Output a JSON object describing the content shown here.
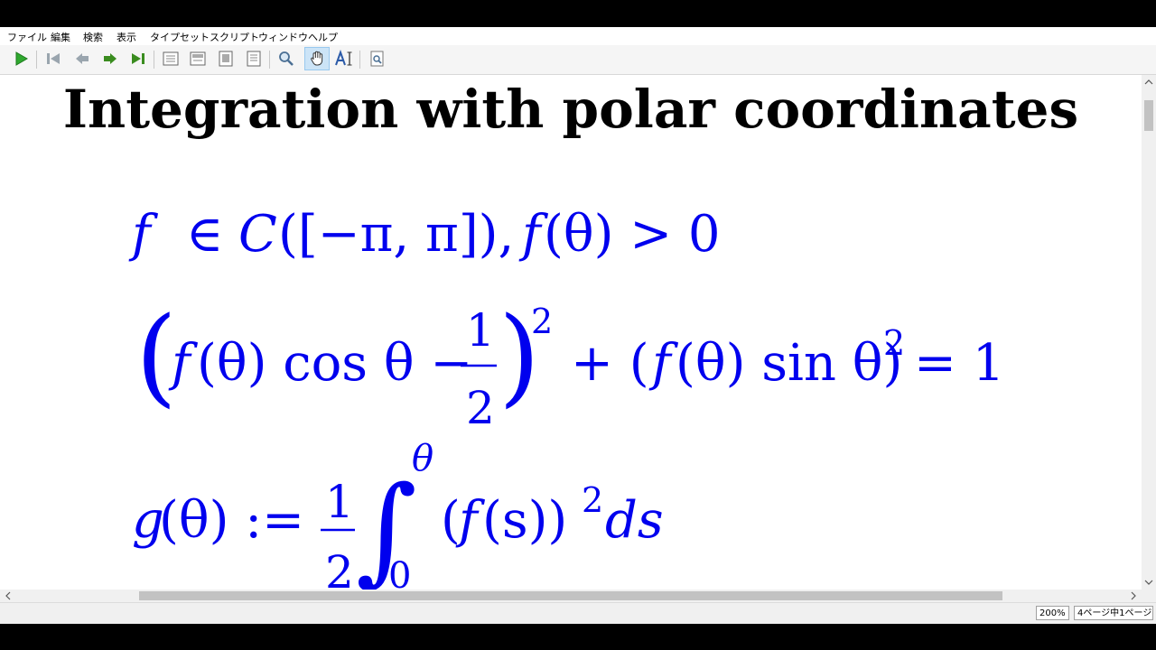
{
  "menu": [
    "ファイル",
    "編集",
    "検索",
    "表示",
    "タイプセット",
    "スクリプト",
    "ウィンドウ",
    "ヘルプ"
  ],
  "toolbar": {
    "icons": [
      "typeset-play-icon",
      "first-page-icon",
      "previous-page-icon",
      "next-page-icon",
      "last-page-icon",
      "actual-size-icon",
      "fit-width-icon",
      "fit-window-icon",
      "fit-height-icon",
      "magnifier-icon",
      "hand-tool-icon",
      "select-text-icon",
      "find-icon"
    ],
    "active": "hand-tool-icon",
    "colors": {
      "play": "#2fa82f",
      "nav": "#3a8c1f",
      "nav_disabled": "#9aa5ae"
    }
  },
  "document": {
    "title": "Integration with polar coordinates",
    "math_color": "#0000ee",
    "line1": {
      "f": "f",
      "in": "∈",
      "C": "C",
      "args": "([−π, π]), ",
      "ftheta": "f",
      "rest": "(θ) > 0"
    },
    "line2": {
      "lparen": "(",
      "f": "f",
      "theta": "(θ) cos θ −",
      "num": "1",
      "den": "2",
      "rparen": ")",
      "exp": "2",
      "plus": "+ (",
      "f2": "f",
      "rest": "(θ) sin θ)",
      "exp2": "2",
      "tail": "= 1"
    },
    "line3": {
      "g": "g",
      "gtheta": "(θ) :=",
      "num": "1",
      "den": "2",
      "integral": "∫",
      "upper": "θ",
      "lower": "0",
      "body_open": "(",
      "f": "f",
      "s": "(s))",
      "exp": "2",
      "ds": "ds"
    }
  },
  "status": {
    "zoom": "200%",
    "page": "4ページ中1ページ"
  }
}
